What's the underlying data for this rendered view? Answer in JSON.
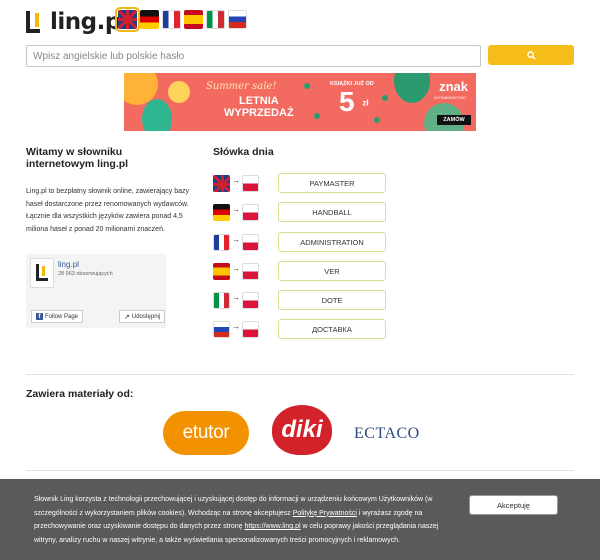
{
  "header": {
    "logo_text": "ling.pl",
    "languages": [
      {
        "code": "en",
        "name": "English",
        "active": true
      },
      {
        "code": "de",
        "name": "German",
        "active": false
      },
      {
        "code": "fr",
        "name": "French",
        "active": false
      },
      {
        "code": "es",
        "name": "Spanish",
        "active": false
      },
      {
        "code": "it",
        "name": "Italian",
        "active": false
      },
      {
        "code": "ru",
        "name": "Russian",
        "active": false
      }
    ]
  },
  "search": {
    "placeholder": "Wpisz angielskie lub polskie hasło",
    "value": "",
    "button_icon": "search-icon"
  },
  "banner": {
    "script_text": "Summer sale!",
    "title_line1": "LETNIA",
    "title_line2": "WYPRZEDAŻ",
    "small_text": "KSIĄŻKI JUŻ OD",
    "price": "5",
    "price_unit": "zł",
    "brand": "znak",
    "brand_sub": "WYDAWNICTWO",
    "cta": "ZAMÓW",
    "colors": {
      "background": "#f26a60",
      "accent": "#2fb58f"
    }
  },
  "welcome": {
    "title": "Witamy w słowniku internetowym ling.pl",
    "description": "Ling.pl to bezpłatny słownik online, zawierający bazy haseł dostarczone przez renomowanych wydawców. Łącznie dla wszystkich języków zawiera ponad 4,5 miliona haseł z ponad 20 milionami znaczeń."
  },
  "facebook": {
    "page_name": "ling.pl",
    "followers": "28 963 obserwujących",
    "follow_label": "Follow Page",
    "share_label": "Udostępnij"
  },
  "words_of_day": {
    "title": "Słówka dnia",
    "items": [
      {
        "from": "en",
        "to": "pl",
        "word": "PAYMASTER"
      },
      {
        "from": "de",
        "to": "pl",
        "word": "HANDBALL"
      },
      {
        "from": "fr",
        "to": "pl",
        "word": "ADMINISTRATION"
      },
      {
        "from": "es",
        "to": "pl",
        "word": "VER"
      },
      {
        "from": "it",
        "to": "pl",
        "word": "DOTE"
      },
      {
        "from": "ru",
        "to": "pl",
        "word": "ДОСТАВКА"
      }
    ]
  },
  "partners": {
    "title": "Zawiera materiały od:",
    "logos": [
      "etutor",
      "diki",
      "ECTACO"
    ]
  },
  "cookie": {
    "text_before_link": "Słownik Ling korzysta z technologii przechowującej i uzyskującej dostęp do informacji w urządzeniu końcowym Użytkowników (w szczególności z wykorzystaniem plików cookies). Wchodząc na stronę akceptujesz ",
    "link1": "Politykę Prywatności",
    "text_mid": " i wyrażasz zgodę na przechowywanie oraz uzyskiwanie dostępu do danych przez stronę ",
    "link2": "https://www.ling.pl",
    "text_after": " w celu poprawy jakości przeglądania naszej witryny, analizy ruchu w naszej witrynie, a także wyświetlania spersonalizowanych treści promocyjnych i reklamowych.",
    "accept_label": "Akceptuję"
  }
}
